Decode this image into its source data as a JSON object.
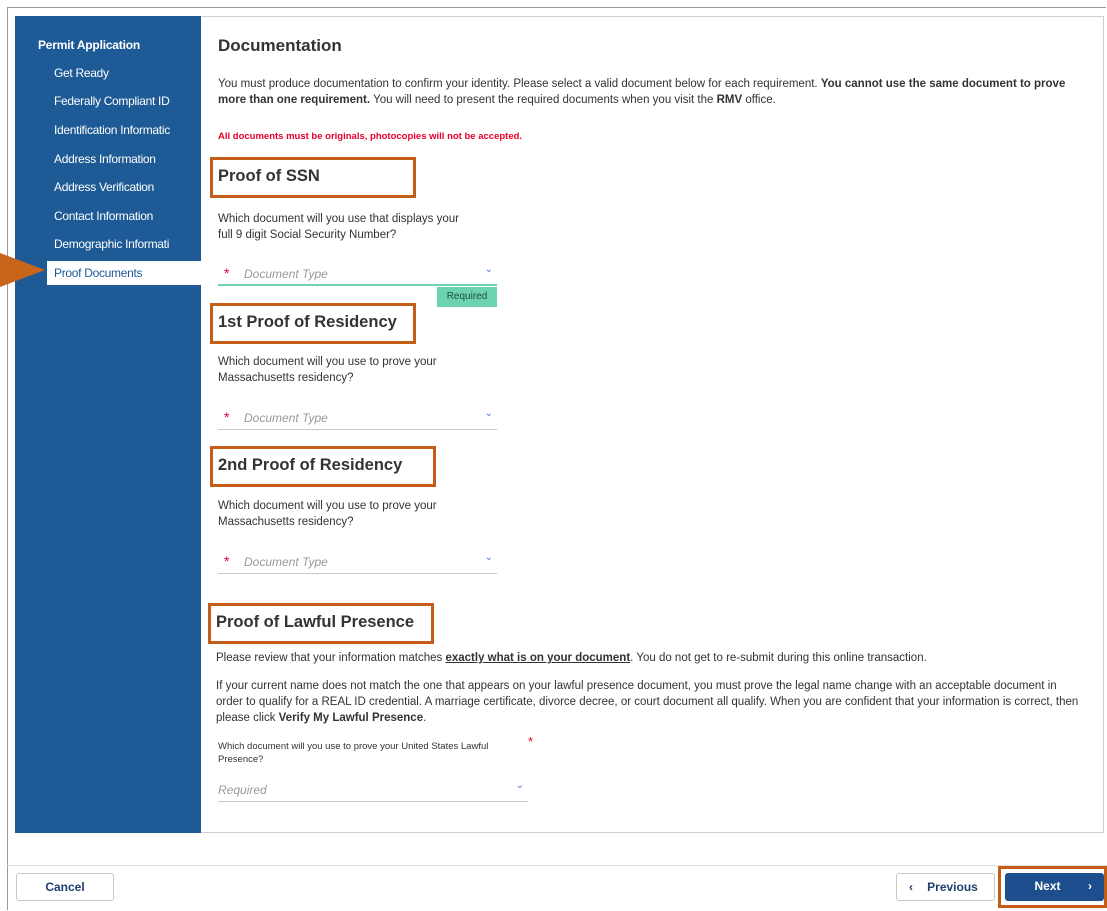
{
  "sidebar": {
    "title": "Permit Application",
    "items": [
      {
        "label": "Get Ready"
      },
      {
        "label": "Federally Compliant ID"
      },
      {
        "label": "Identification Informatic"
      },
      {
        "label": "Address Information"
      },
      {
        "label": "Address Verification"
      },
      {
        "label": "Contact Information"
      },
      {
        "label": "Demographic Informati"
      },
      {
        "label": "Proof Documents",
        "active": true
      }
    ]
  },
  "main": {
    "title": "Documentation",
    "intro_part1": "You must produce documentation to confirm your identity. Please select a valid document below for each requirement. ",
    "intro_bold": "You cannot use the same document to prove more than one requirement.",
    "intro_part2": " You will need to present the required documents when you visit the ",
    "intro_rmv": "RMV",
    "intro_part3": " office.",
    "warning": "All documents must be originals, photocopies will not be accepted."
  },
  "sections": {
    "ssn": {
      "heading": "Proof of SSN",
      "question_line1": "Which document will you use that displays your",
      "question_line2": "full 9 digit Social Security Number?",
      "required_mark": "*",
      "placeholder": "Document Type",
      "badge": "Required"
    },
    "residency1": {
      "heading": "1st Proof of Residency",
      "question_line1": "Which document will you use to prove your",
      "question_line2": "Massachusetts residency?",
      "required_mark": "*",
      "placeholder": "Document Type"
    },
    "residency2": {
      "heading": "2nd Proof of Residency",
      "question_line1": "Which document will you use to prove your",
      "question_line2": "Massachusetts residency?",
      "required_mark": "*",
      "placeholder": "Document Type"
    },
    "lawful": {
      "heading": "Proof of Lawful Presence",
      "p1_a": "Please review that your information matches ",
      "p1_link": "exactly what is on your document",
      "p1_b": ". You do not get to re-submit during this online transaction.",
      "p2_a": "If your current name does not match the one that appears on your lawful presence document, you must prove the legal name change with an acceptable document in order to qualify for a REAL ID credential. A marriage certificate, divorce decree, or court document all qualify. When you are confident that your information is correct, then please click ",
      "p2_bold": "Verify My Lawful Presence",
      "p2_b": ".",
      "question": "Which document will you use to prove your United States Lawful Presence?",
      "required_mark": "*",
      "placeholder": "Required"
    }
  },
  "footer": {
    "cancel": "Cancel",
    "previous": "Previous",
    "next": "Next"
  },
  "icons": {
    "chevron": "chevron-down-icon",
    "prev": "chevron-left-icon",
    "next": "chevron-right-icon"
  },
  "colors": {
    "sidebar": "#1d5a96",
    "highlight": "#c45d16",
    "required": "#e4002b",
    "badge": "#6dd2b0"
  }
}
